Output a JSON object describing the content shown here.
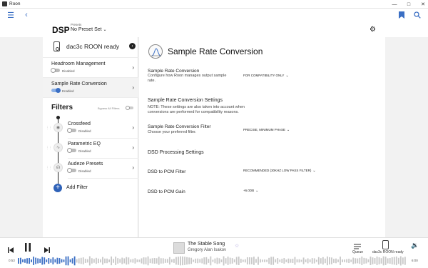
{
  "window": {
    "title": "Roon",
    "controls": [
      "minimize",
      "maximize",
      "close"
    ]
  },
  "nav": {
    "icons": [
      "hamburger-icon",
      "back-icon",
      "bookmark-icon",
      "search-icon"
    ]
  },
  "dsp": {
    "title": "DSP",
    "presets_label": "Presets",
    "presets_value": "No Preset Set"
  },
  "left_panel": {
    "device_name": "dac3c ROON ready",
    "items": [
      {
        "label": "Headroom Management",
        "state": "Disabled",
        "on": false
      },
      {
        "label": "Sample Rate Conversion",
        "state": "Enabled",
        "on": true
      }
    ],
    "filters_header": "Filters",
    "bypass_label": "Bypass All Filters",
    "filters": [
      {
        "label": "Crossfeed",
        "state": "Disabled"
      },
      {
        "label": "Parametric EQ",
        "state": "Disabled"
      },
      {
        "label": "Audeze Presets",
        "state": "Disabled"
      }
    ],
    "add_filter": "Add Filter"
  },
  "main": {
    "title": "Sample Rate Conversion",
    "src": {
      "heading": "Sample Rate Conversion",
      "desc_line1": "Configure how Roon manages output sample",
      "desc_line2": "rate.",
      "value": "FOR COMPATIBILITY ONLY"
    },
    "settings": {
      "heading": "Sample Rate Conversion Settings",
      "note_line1": "NOTE: These settings are also taken into account when",
      "note_line2": "conversions are performed for compatibility reasons."
    },
    "filter": {
      "heading": "Sample Rate Conversion Filter",
      "desc": "Choose your preferred filter.",
      "value": "PRECISE, MINIMUM PHASE"
    },
    "dsd": {
      "heading": "DSD Processing Settings",
      "pcm_filter_label": "DSD to PCM Filter",
      "pcm_filter_value": "RECOMMENDED (30KHZ LOW PASS FILTER)",
      "pcm_gain_label": "DSD to PCM Gain",
      "pcm_gain_value": "+6.0DB"
    }
  },
  "player": {
    "track_title": "The Stable Song",
    "artist": "Gregory Alan Isakov",
    "queue_label": "Queue",
    "zone_label": "dac3c ROON ready",
    "time_elapsed": "0:53",
    "time_total": "6:00",
    "progress": 0.147,
    "accent": "#3b6fc4"
  }
}
